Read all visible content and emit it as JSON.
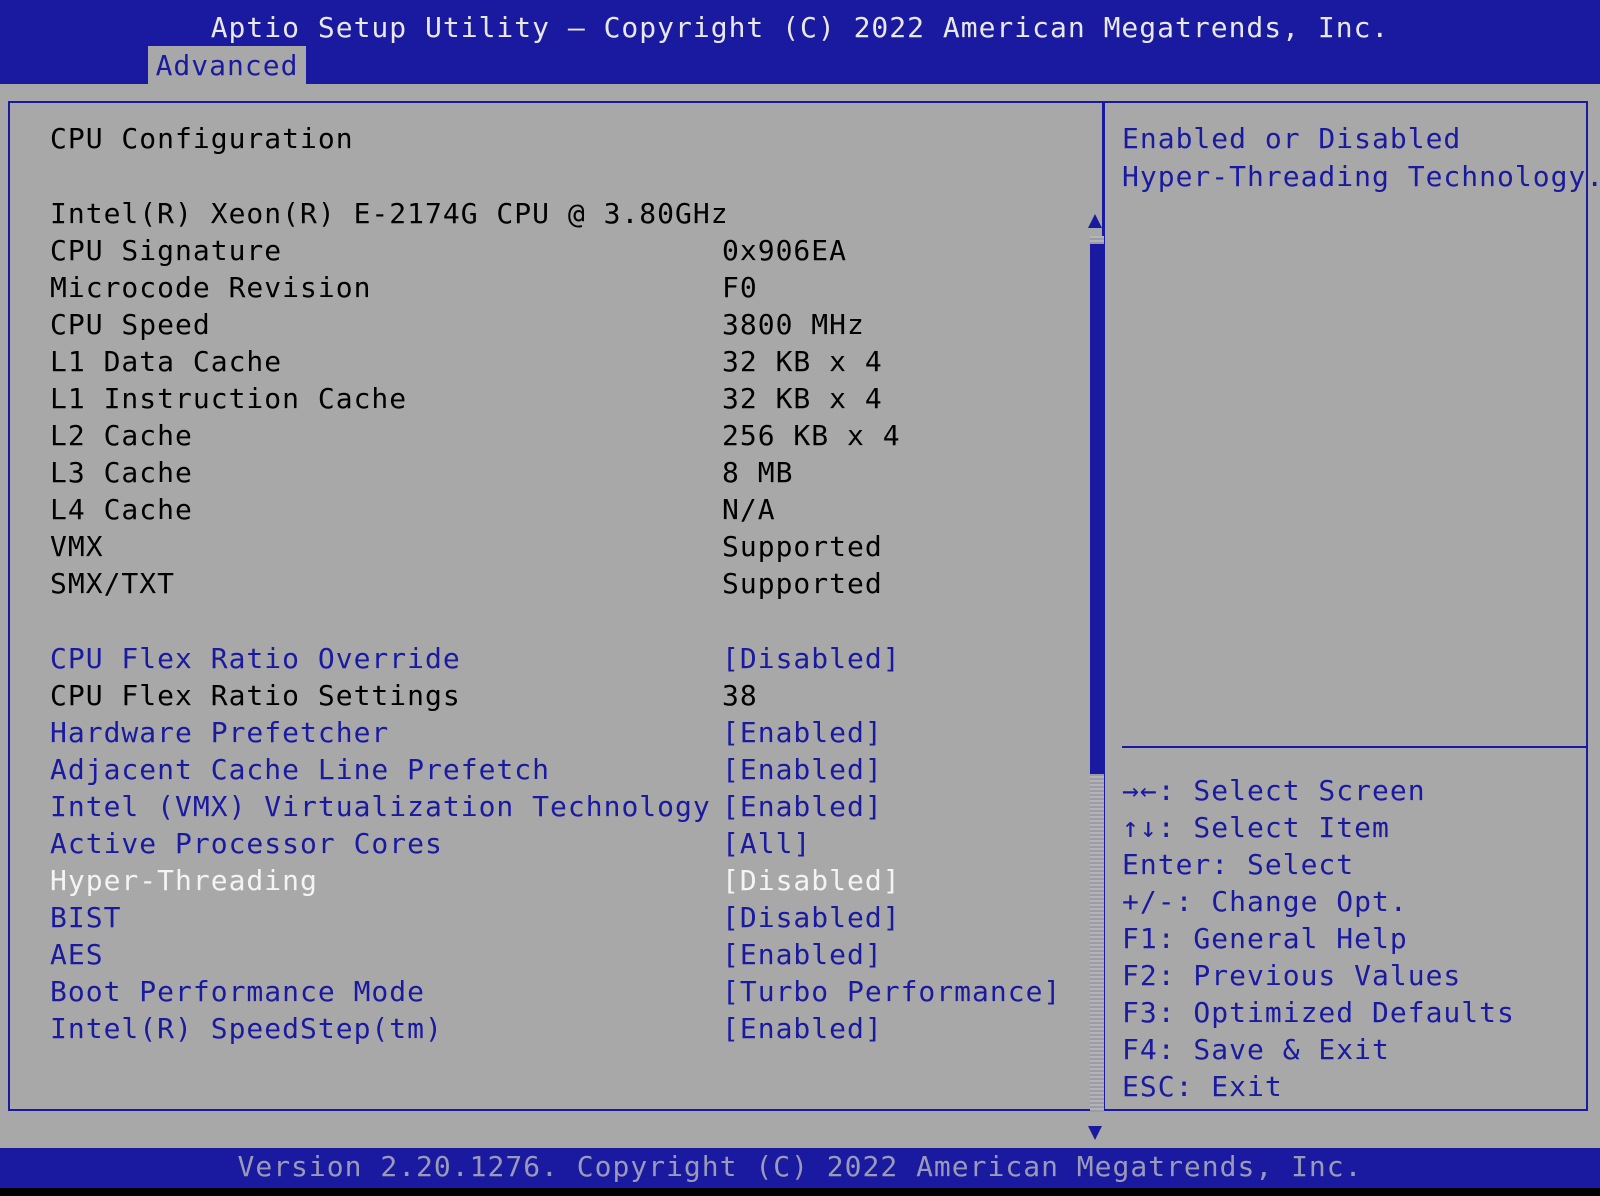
{
  "header": {
    "title": "Aptio Setup Utility – Copyright (C) 2022 American Megatrends, Inc.",
    "active_tab": "Advanced"
  },
  "section_title": "CPU Configuration",
  "processor_name": "Intel(R) Xeon(R) E-2174G CPU @ 3.80GHz",
  "info_rows": [
    {
      "label": "CPU Signature",
      "value": "0x906EA"
    },
    {
      "label": "Microcode Revision",
      "value": "F0"
    },
    {
      "label": "CPU Speed",
      "value": "3800 MHz"
    },
    {
      "label": "L1 Data Cache",
      "value": "32 KB x 4"
    },
    {
      "label": "L1 Instruction Cache",
      "value": "32 KB x 4"
    },
    {
      "label": "L2 Cache",
      "value": "256 KB x 4"
    },
    {
      "label": "L3 Cache",
      "value": "8 MB"
    },
    {
      "label": "L4 Cache",
      "value": "N/A"
    },
    {
      "label": "VMX",
      "value": "Supported"
    },
    {
      "label": "SMX/TXT",
      "value": "Supported"
    }
  ],
  "settings": [
    {
      "label": "CPU Flex Ratio Override",
      "value": "[Disabled]"
    },
    {
      "label": "CPU Flex Ratio Settings",
      "value": "38"
    },
    {
      "label": "Hardware Prefetcher",
      "value": "[Enabled]"
    },
    {
      "label": "Adjacent Cache Line Prefetch",
      "value": "[Enabled]"
    },
    {
      "label": "Intel (VMX) Virtualization Technology",
      "value": "[Enabled]"
    },
    {
      "label": "Active Processor Cores",
      "value": "[All]"
    },
    {
      "label": "Hyper-Threading",
      "value": "[Disabled]"
    },
    {
      "label": "BIST",
      "value": "[Disabled]"
    },
    {
      "label": "AES",
      "value": "[Enabled]"
    },
    {
      "label": "Boot Performance Mode",
      "value": "[Turbo Performance]"
    },
    {
      "label": "Intel(R) SpeedStep(tm)",
      "value": "[Enabled]"
    }
  ],
  "help": {
    "line1": "Enabled or Disabled",
    "line2": "Hyper-Threading Technology."
  },
  "keys": [
    "→←: Select Screen",
    "↑↓: Select Item",
    "Enter: Select",
    "+/-: Change Opt.",
    "F1: General Help",
    "F2: Previous Values",
    "F3: Optimized Defaults",
    "F4: Save & Exit",
    "ESC: Exit"
  ],
  "footer": "Version 2.20.1276. Copyright (C) 2022 American Megatrends, Inc.",
  "colors": {
    "header_blue": "#1a1aa0",
    "panel_gray": "#a8a8a8",
    "highlight_white": "#f4f4f4"
  }
}
